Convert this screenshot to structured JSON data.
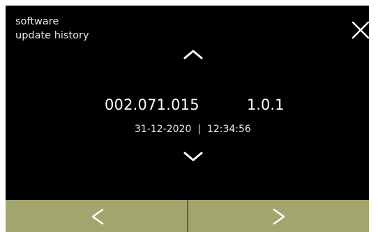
{
  "header": {
    "title_line1": "software",
    "title_line2": "update history"
  },
  "entry": {
    "software_version": "002.071.015",
    "version": "1.0.1",
    "date": "31-12-2020",
    "separator": "|",
    "time": "12:34:56"
  },
  "icons": {
    "close": "close-icon",
    "scroll_up": "chevron-up-icon",
    "scroll_down": "chevron-down-icon",
    "previous": "chevron-left-icon",
    "next": "chevron-right-icon"
  },
  "colors": {
    "screen_background": "#000000",
    "text": "#ffffff",
    "nav_bar": "#a3a56e",
    "nav_divider": "#5f6040"
  }
}
